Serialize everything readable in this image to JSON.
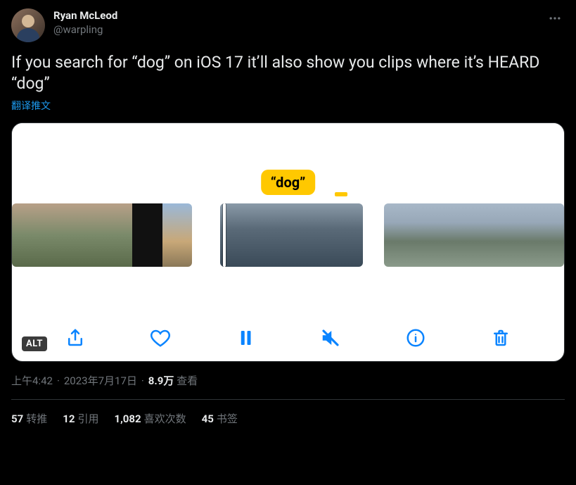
{
  "author": {
    "display_name": "Ryan McLeod",
    "handle": "@warpling"
  },
  "tweet_text": "If you search for “dog” on iOS 17 it’ll also show you clips where it’s HEARD “dog”",
  "translate_label": "翻译推文",
  "media": {
    "search_token": "“dog”",
    "alt_badge": "ALT"
  },
  "meta": {
    "time": "上午4:42",
    "sep": " · ",
    "date": "2023年7月17日",
    "views_count": "8.9万",
    "views_label": " 查看"
  },
  "stats": {
    "retweets_count": "57",
    "retweets_label": "转推",
    "quotes_count": "12",
    "quotes_label": "引用",
    "likes_count": "1,082",
    "likes_label": "喜欢次数",
    "bookmarks_count": "45",
    "bookmarks_label": "书签"
  }
}
